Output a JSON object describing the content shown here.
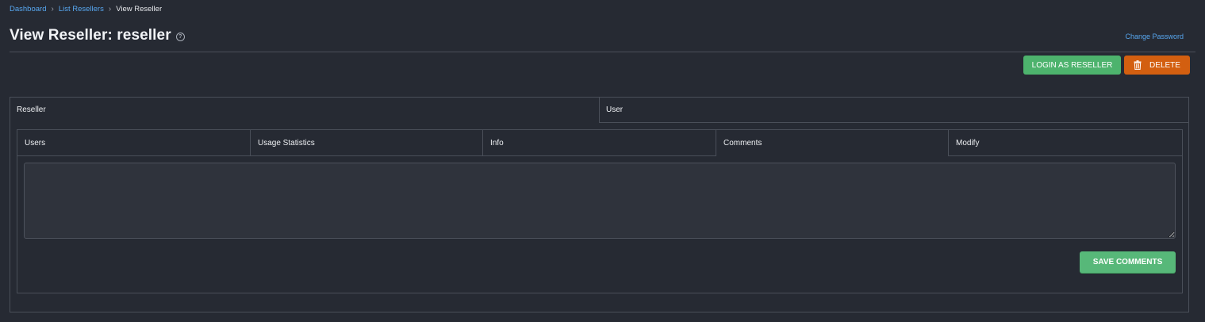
{
  "breadcrumb": {
    "items": [
      "Dashboard",
      "List Resellers"
    ],
    "current": "View Reseller",
    "separator": "›"
  },
  "header": {
    "title": "View Reseller: reseller",
    "help_icon": "?",
    "change_password_label": "Change Password"
  },
  "actions": {
    "login_as_reseller_label": "LOGIN AS RESELLER",
    "delete_label": "DELETE"
  },
  "outer_tabs": [
    {
      "label": "Reseller"
    },
    {
      "label": "User"
    }
  ],
  "inner_tabs": [
    {
      "label": "Users"
    },
    {
      "label": "Usage Statistics"
    },
    {
      "label": "Info"
    },
    {
      "label": "Comments",
      "active": true
    },
    {
      "label": "Modify"
    }
  ],
  "comments": {
    "value": "",
    "save_label": "SAVE COMMENTS"
  },
  "colors": {
    "background": "#262a33",
    "link": "#57a7f0",
    "login_button": "#4db36d",
    "delete_button": "#d35f10",
    "save_button": "#57b879",
    "border": "#4a4f59"
  },
  "icons": {
    "delete": "trash-icon",
    "help": "help-icon",
    "breadcrumb_separator": "chevron-right-icon"
  }
}
